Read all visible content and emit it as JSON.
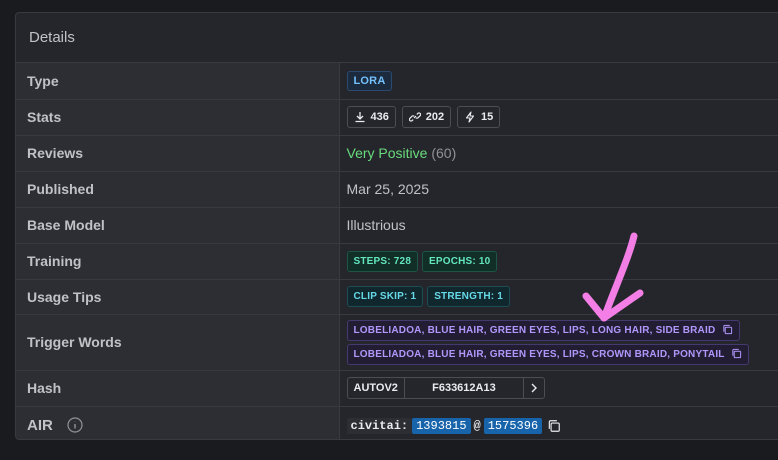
{
  "card": {
    "title": "Details"
  },
  "rows": {
    "type": {
      "label": "Type",
      "badge": "LORA"
    },
    "stats": {
      "label": "Stats",
      "downloads": "436",
      "links": "202",
      "bolts": "15"
    },
    "reviews": {
      "label": "Reviews",
      "value": "Very Positive",
      "count": "(60)"
    },
    "published": {
      "label": "Published",
      "value": "Mar 25, 2025"
    },
    "base_model": {
      "label": "Base Model",
      "value": "Illustrious"
    },
    "training": {
      "label": "Training",
      "steps": "STEPS: 728",
      "epochs": "EPOCHS: 10"
    },
    "usage_tips": {
      "label": "Usage Tips",
      "clip_skip": "CLIP SKIP: 1",
      "strength": "STRENGTH: 1"
    },
    "trigger_words": {
      "label": "Trigger Words",
      "words": [
        "LOBELIADOA, BLUE HAIR, GREEN EYES, LIPS, LONG HAIR, SIDE BRAID",
        "LOBELIADOA, BLUE HAIR, GREEN EYES, LIPS, CROWN BRAID, PONYTAIL"
      ]
    },
    "hash": {
      "label": "Hash",
      "algo": "AUTOV2",
      "value": "F633612A13"
    },
    "air": {
      "label": "AIR",
      "prefix": "civitai:",
      "model_id": "1393815",
      "at": "@",
      "version_id": "1575396"
    }
  },
  "colors": {
    "annotation": "#f27ee6",
    "accent": "#1864ab"
  }
}
